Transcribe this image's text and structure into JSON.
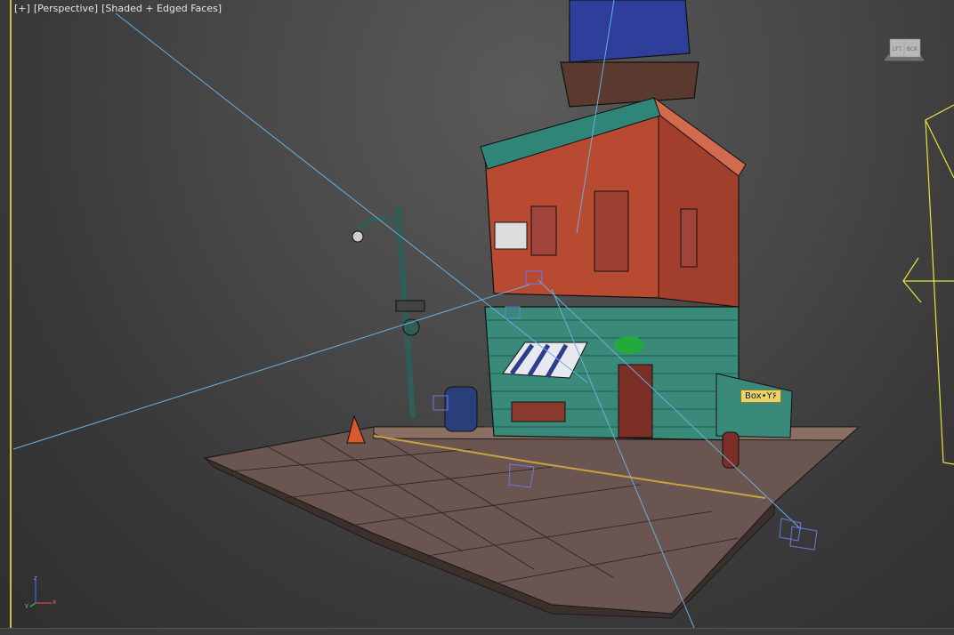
{
  "viewport": {
    "label": {
      "plus": "[+]",
      "view": "[Perspective]",
      "shading": "[Shaded + Edged Faces]"
    },
    "accent_color": "#d7b94a"
  },
  "viewcube": {
    "left_face": "LFT",
    "right_face": "BCK"
  },
  "object_tooltip": "Box•Y۶",
  "axis": {
    "x": "x",
    "y": "y",
    "z": "z"
  },
  "colors": {
    "brick": "#b94a32",
    "teal": "#3a8a7a",
    "sidewalk": "#6e5650",
    "helper": "#6aaee0",
    "camera": "#e8e43a",
    "selected_outline": "#d7b94a"
  },
  "icons": [
    "viewcube-icon",
    "axis-tripod-icon",
    "camera-icon",
    "light-helper-icon"
  ]
}
